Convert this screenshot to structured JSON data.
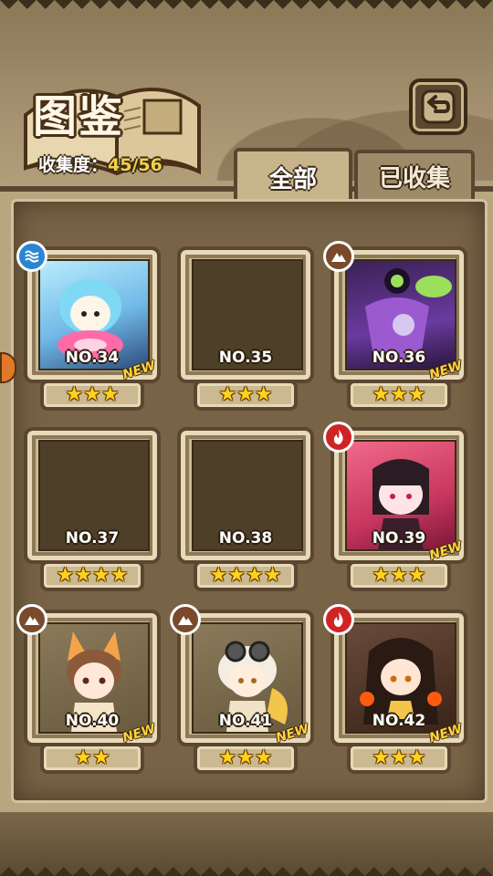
{
  "header": {
    "title": "图鉴",
    "collection_label": "收集度：",
    "collection_value": "45/56"
  },
  "tabs": [
    {
      "label": "全部",
      "active": true
    },
    {
      "label": "已收集",
      "active": false
    }
  ],
  "cards": [
    {
      "number": "NO.34",
      "stars": 3,
      "star_text": "★★★",
      "element": "water-icon",
      "is_new": true,
      "new_label": "NEW",
      "unlocked": true
    },
    {
      "number": "NO.35",
      "stars": 3,
      "star_text": "★★★",
      "element": null,
      "is_new": false,
      "new_label": "",
      "unlocked": false
    },
    {
      "number": "NO.36",
      "stars": 3,
      "star_text": "★★★",
      "element": "earth-icon",
      "is_new": true,
      "new_label": "NEW",
      "unlocked": true
    },
    {
      "number": "NO.37",
      "stars": 4,
      "star_text": "★★★★",
      "element": null,
      "is_new": false,
      "new_label": "",
      "unlocked": false
    },
    {
      "number": "NO.38",
      "stars": 4,
      "star_text": "★★★★",
      "element": null,
      "is_new": false,
      "new_label": "",
      "unlocked": false
    },
    {
      "number": "NO.39",
      "stars": 3,
      "star_text": "★★★",
      "element": "fire-icon",
      "is_new": true,
      "new_label": "NEW",
      "unlocked": true
    },
    {
      "number": "NO.40",
      "stars": 2,
      "star_text": "★★",
      "element": "earth-icon",
      "is_new": true,
      "new_label": "NEW",
      "unlocked": true
    },
    {
      "number": "NO.41",
      "stars": 3,
      "star_text": "★★★",
      "element": "earth-icon",
      "is_new": true,
      "new_label": "NEW",
      "unlocked": true
    },
    {
      "number": "NO.42",
      "stars": 3,
      "star_text": "★★★",
      "element": "fire-icon",
      "is_new": true,
      "new_label": "NEW",
      "unlocked": true
    }
  ],
  "colors": {
    "panel": "#b9a57f",
    "frame_dark": "#5b4630",
    "star": "#ffd21f",
    "new_text": "#ffd43b",
    "water": "#2b86d0",
    "earth": "#7a4a2c",
    "fire": "#d02424"
  }
}
